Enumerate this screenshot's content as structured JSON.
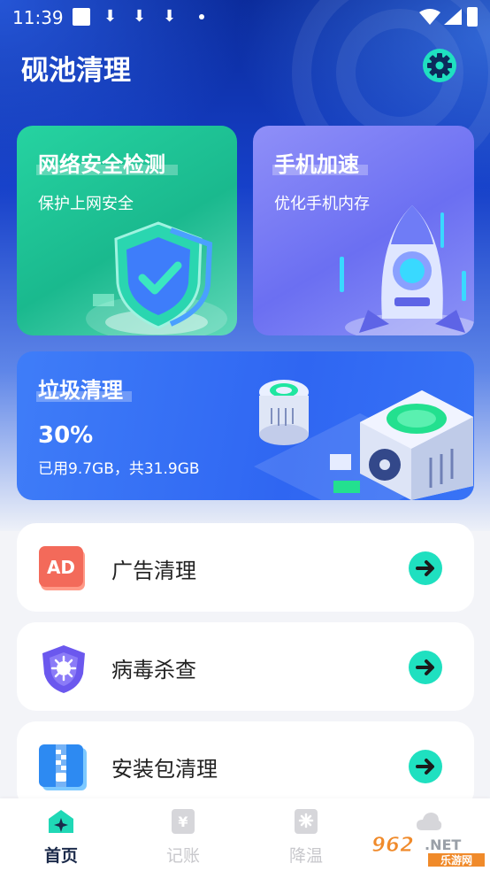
{
  "status_bar": {
    "time": "11:39",
    "icons": [
      "screen-record-icon",
      "download-icon",
      "download-icon",
      "download-icon",
      "dot-icon",
      "wifi-icon",
      "signal-icon",
      "battery-icon"
    ]
  },
  "header": {
    "title": "砚池清理",
    "settings_icon": "gear-icon"
  },
  "feature_cards": [
    {
      "title": "网络安全检测",
      "subtitle": "保护上网安全",
      "illustration": "shield-icon",
      "color": "#21c99a"
    },
    {
      "title": "手机加速",
      "subtitle": "优化手机内存",
      "illustration": "rocket-icon",
      "color": "#7a7ff5"
    }
  ],
  "junk_card": {
    "title": "垃圾清理",
    "percent": "30%",
    "usage": "已用9.7GB，共31.9GB",
    "usage_fraction": 0.3,
    "illustration": "cleaner-machine-icon",
    "color": "#3470f5"
  },
  "list": [
    {
      "label": "广告清理",
      "icon": "ad-icon"
    },
    {
      "label": "病毒杀查",
      "icon": "virus-shield-icon"
    },
    {
      "label": "安装包清理",
      "icon": "zip-package-icon"
    }
  ],
  "tabbar": {
    "tabs": [
      {
        "label": "首页",
        "icon": "home-icon",
        "active": true
      },
      {
        "label": "记账",
        "icon": "ledger-icon",
        "active": false
      },
      {
        "label": "降温",
        "icon": "cool-icon",
        "active": false
      },
      {
        "label": "",
        "icon": "cloud-icon",
        "active": false
      }
    ]
  },
  "watermark": {
    "text": "962.NET",
    "subtext": "乐游网"
  },
  "colors": {
    "accent_teal": "#1fe0c0",
    "arrow": "#222222",
    "tab_active": "#1b2a4a",
    "tab_inactive": "#c8c8cc"
  }
}
